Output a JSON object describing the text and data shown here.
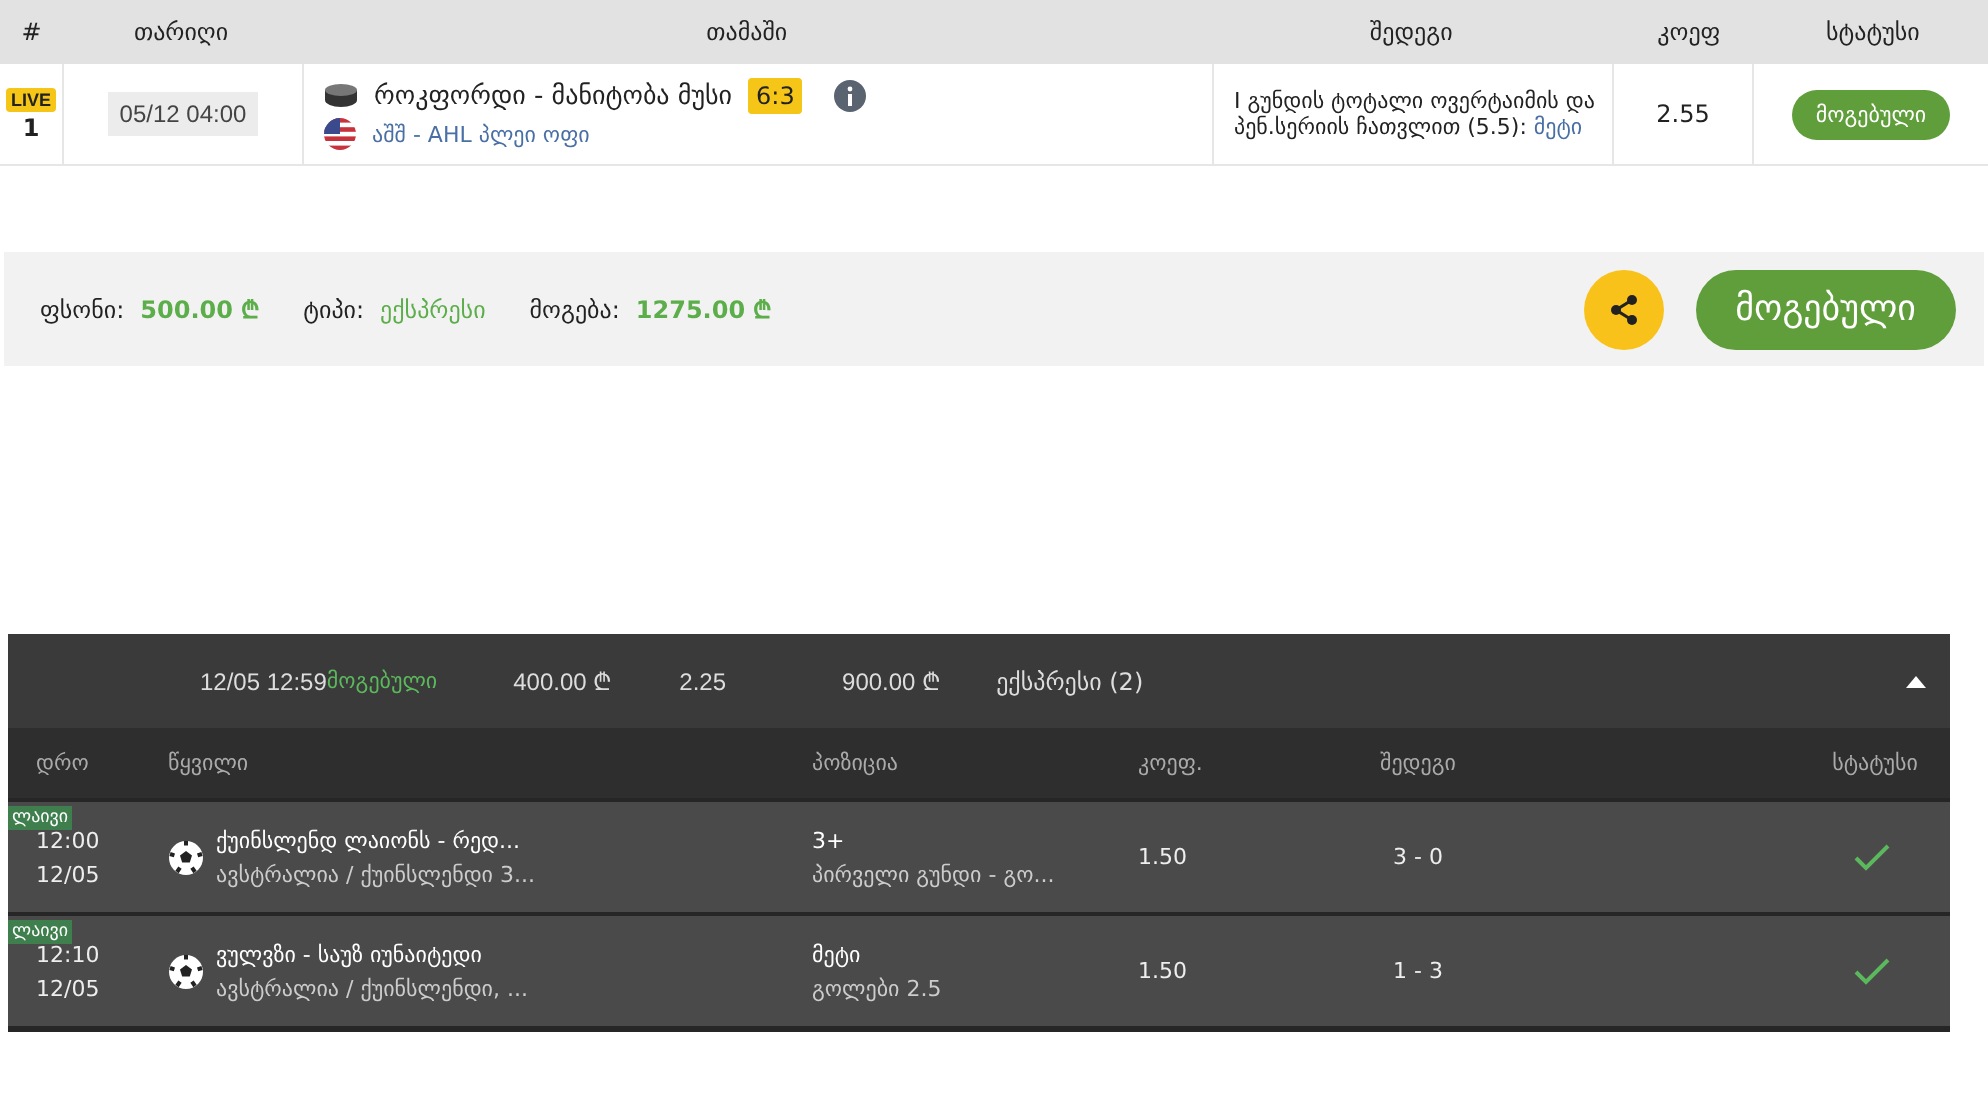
{
  "bet_table": {
    "columns": [
      "#",
      "თარიღი",
      "თამაში",
      "შედეგი",
      "კოეფ",
      "სტატუსი"
    ],
    "rows": [
      {
        "live_badge": "LIVE",
        "number": "1",
        "date": "05/12 04:00",
        "game": "როკფორდი - მანიტობა მუსი",
        "score": "6:3",
        "league": "აშშ - AHL პლეი ოფი",
        "result_text": "I გუნდის ტოტალი ოვერტაიმის და პენ.სერიის ჩათვლით (5.5):",
        "result_pick": "მეტი",
        "odds": "2.55",
        "status": "მოგებული"
      }
    ]
  },
  "summary": {
    "stake_label": "ფსონი:",
    "stake": "500.00 ₾",
    "type_label": "ტიპი:",
    "type": "ექსპრესი",
    "win_label": "მოგება:",
    "win": "1275.00 ₾",
    "status": "მოგებული"
  },
  "history": {
    "expanded": true,
    "datetime": "12/05 12:59",
    "status": "მოგებული",
    "stake": "400.00 ₾",
    "odds": "2.25",
    "payout": "900.00 ₾",
    "type": "ექსპრესი (2)",
    "columns": [
      "დრო",
      "წყვილი",
      "პოზიცია",
      "კოეფ.",
      "შედეგი",
      "სტატუსი"
    ],
    "rows": [
      {
        "tag": "ლაივი",
        "time": "12:00",
        "date": "12/05",
        "pair": "ქუინსლენდ ლაიონს - რედ...",
        "league": "ავსტრალია / ქუინსლენდი 3...",
        "position": "3+",
        "market": "პირველი გუნდი - გო...",
        "odds": "1.50",
        "result": "3 - 0",
        "won": true
      },
      {
        "tag": "ლაივი",
        "time": "12:10",
        "date": "12/05",
        "pair": "ვულვზი - საუზ იუნაიტედი",
        "league": "ავსტრალია / ქუინსლენდი, ...",
        "position": "მეტი",
        "market": "გოლები 2.5",
        "odds": "1.50",
        "result": "1 - 3",
        "won": true
      }
    ]
  }
}
